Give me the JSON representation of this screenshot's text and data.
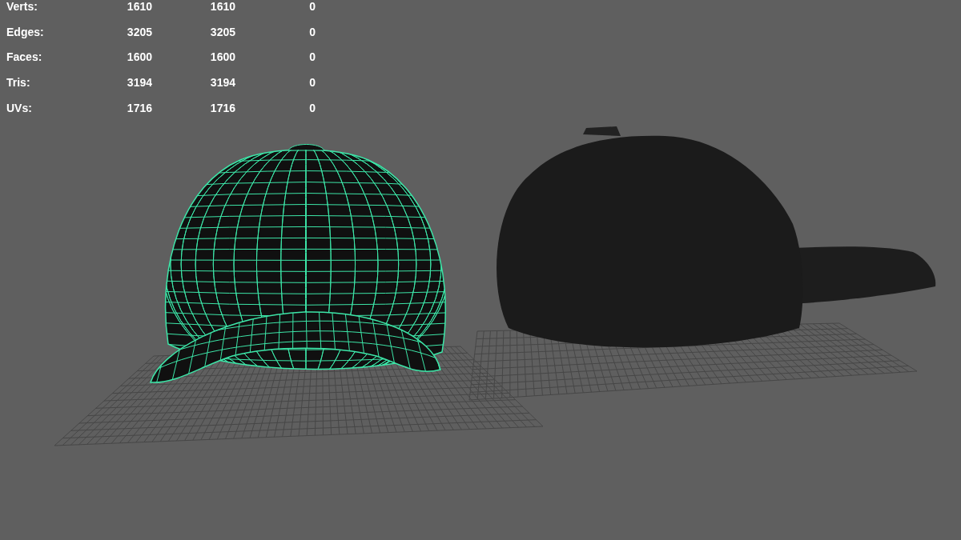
{
  "stats": [
    {
      "label": "Verts:",
      "values": [
        "1610",
        "1610",
        "0"
      ]
    },
    {
      "label": "Edges:",
      "values": [
        "3205",
        "3205",
        "0"
      ]
    },
    {
      "label": "Faces:",
      "values": [
        "1600",
        "1600",
        "0"
      ]
    },
    {
      "label": "Tris:",
      "values": [
        "3194",
        "3194",
        "0"
      ]
    },
    {
      "label": "UVs:",
      "values": [
        "1716",
        "1716",
        "0"
      ]
    }
  ]
}
